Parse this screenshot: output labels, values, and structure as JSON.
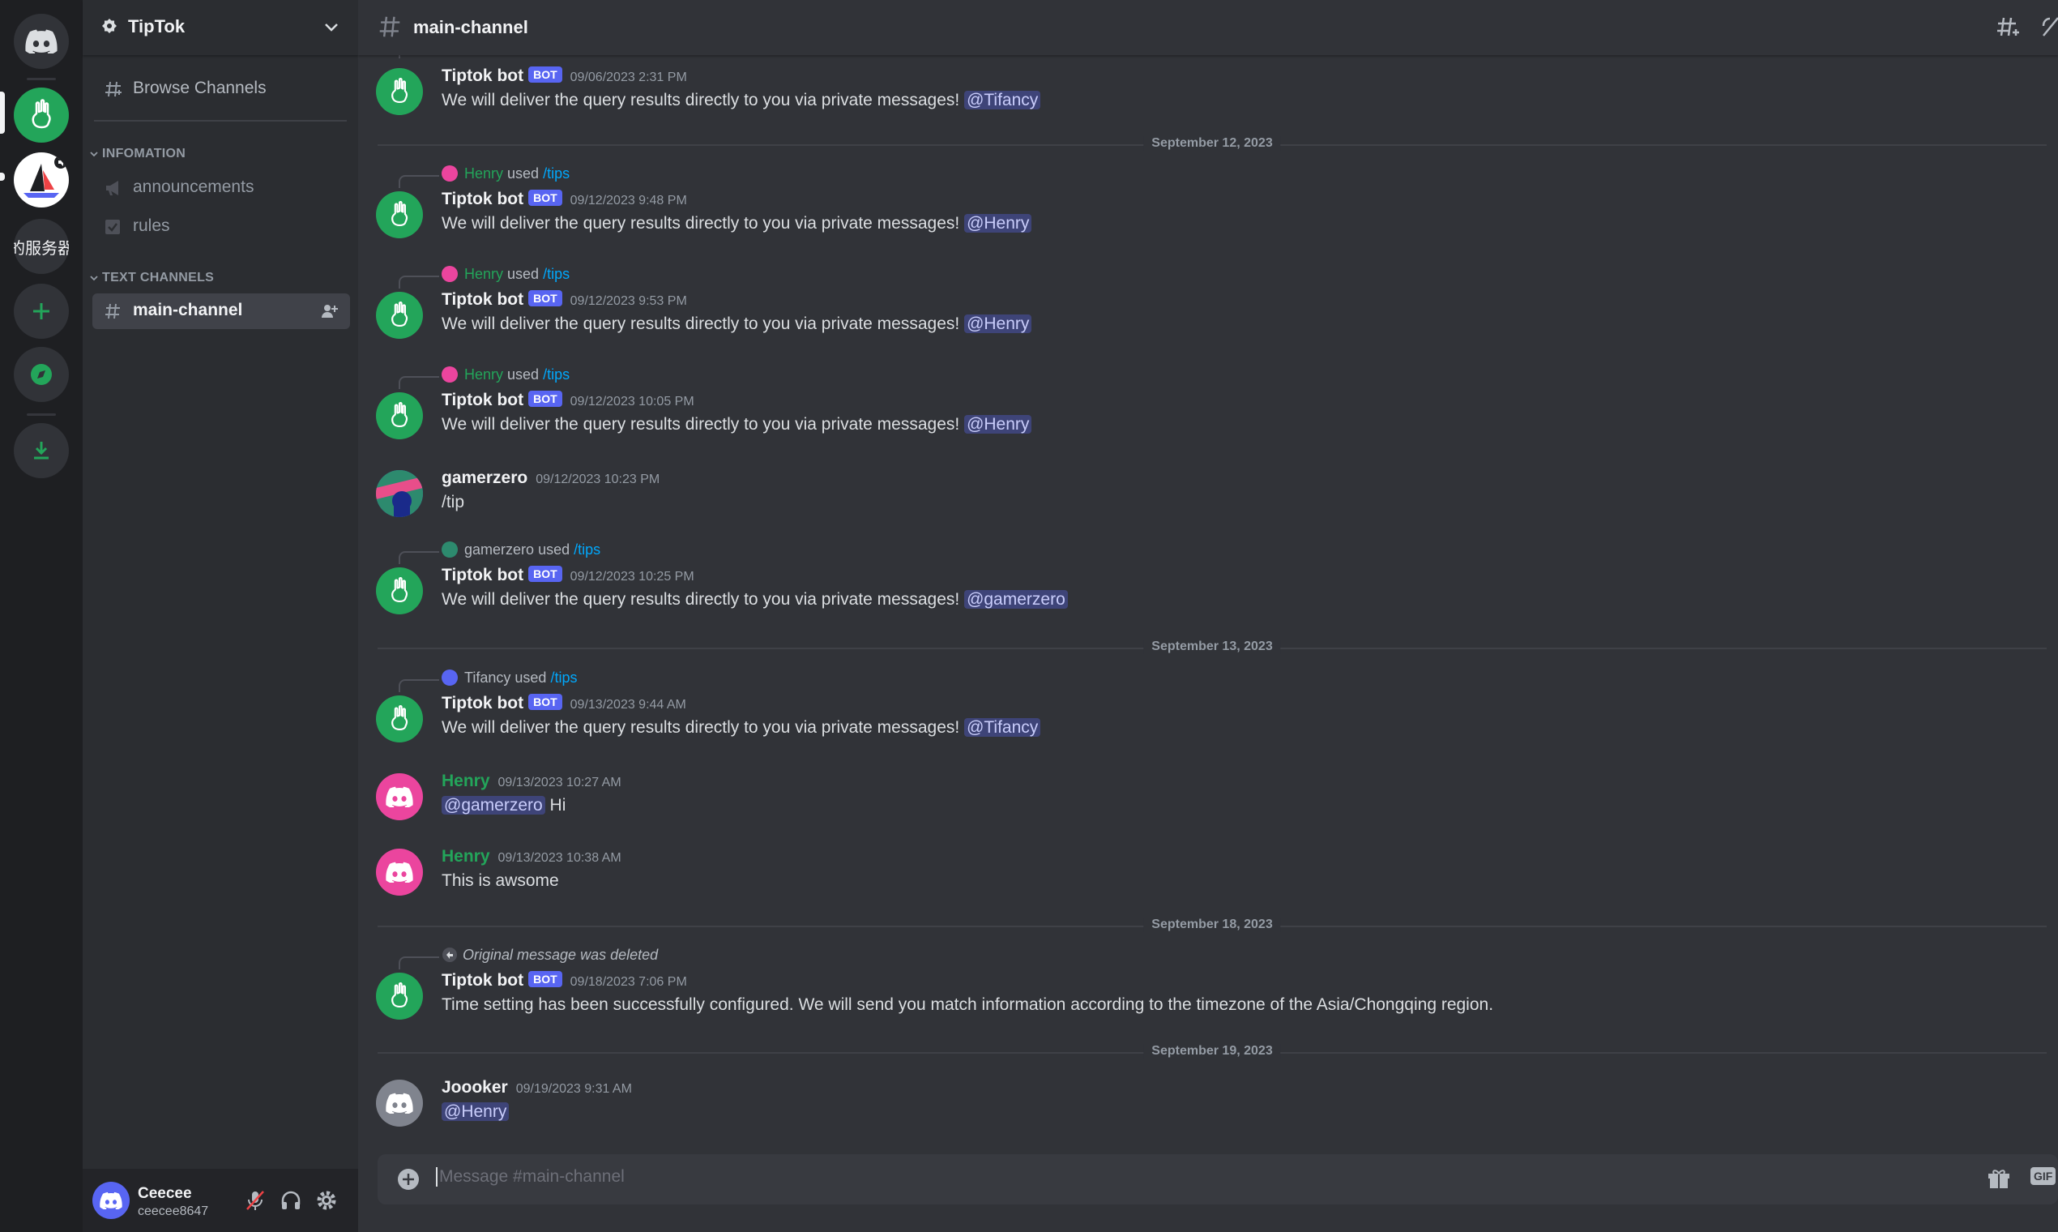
{
  "server_rail": {
    "text_server_label": "的服务器"
  },
  "guild": {
    "name": "TipTok",
    "browse_channels": "Browse Channels",
    "categories": [
      {
        "label": "INFOMATION",
        "channels": [
          "announcements",
          "rules"
        ]
      },
      {
        "label": "TEXT CHANNELS",
        "channels": [
          "main-channel"
        ]
      }
    ]
  },
  "user": {
    "display_name": "Ceecee",
    "tag": "ceecee8647"
  },
  "channel": {
    "title": "main-channel"
  },
  "composer": {
    "placeholder": "Message #main-channel",
    "gif_label": "GIF"
  },
  "dates": [
    "September 12, 2023",
    "September 13, 2023",
    "September 18, 2023",
    "September 19, 2023"
  ],
  "messages": [
    {
      "author": "Tiptok bot",
      "bot": "BOT",
      "time": "09/06/2023 2:31 PM",
      "text": "We will deliver the query results directly to you via private messages!",
      "mention": "@Tifancy"
    },
    {
      "reply_user": "Henry",
      "reply_used": "used",
      "reply_cmd": "/tips",
      "author": "Tiptok bot",
      "bot": "BOT",
      "time": "09/12/2023 9:48 PM",
      "text": "We will deliver the query results directly to you via private messages!",
      "mention": "@Henry"
    },
    {
      "reply_user": "Henry",
      "reply_used": "used",
      "reply_cmd": "/tips",
      "author": "Tiptok bot",
      "bot": "BOT",
      "time": "09/12/2023 9:53 PM",
      "text": "We will deliver the query results directly to you via private messages!",
      "mention": "@Henry"
    },
    {
      "reply_user": "Henry",
      "reply_used": "used",
      "reply_cmd": "/tips",
      "author": "Tiptok bot",
      "bot": "BOT",
      "time": "09/12/2023 10:05 PM",
      "text": "We will deliver the query results directly to you via private messages!",
      "mention": "@Henry"
    },
    {
      "author": "gamerzero",
      "time": "09/12/2023 10:23 PM",
      "text": "/tip"
    },
    {
      "reply_user": "gamerzero",
      "reply_used": "used",
      "reply_cmd": "/tips",
      "author": "Tiptok bot",
      "bot": "BOT",
      "time": "09/12/2023 10:25 PM",
      "text": "We will deliver the query results directly to you via private messages!",
      "mention": "@gamerzero"
    },
    {
      "reply_user": "Tifancy",
      "reply_used": "used",
      "reply_cmd": "/tips",
      "author": "Tiptok bot",
      "bot": "BOT",
      "time": "09/13/2023 9:44 AM",
      "text": "We will deliver the query results directly to you via private messages!",
      "mention": "@Tifancy"
    },
    {
      "author": "Henry",
      "time": "09/13/2023 10:27 AM",
      "mention": "@gamerzero",
      "text": "Hi"
    },
    {
      "author": "Henry",
      "time": "09/13/2023 10:38 AM",
      "text": "This is awsome"
    },
    {
      "reply_deleted": "Original message was deleted",
      "author": "Tiptok bot",
      "bot": "BOT",
      "time": "09/18/2023 7:06 PM",
      "text": "Time setting has been successfully configured. We will send you match information according to the timezone of the Asia/Chongqing region."
    },
    {
      "author": "Joooker",
      "time": "09/19/2023 9:31 AM",
      "mention": "@Henry"
    }
  ],
  "colors": {
    "accent": "#5865f2",
    "online_green": "#23a55a",
    "henry_pink": "#eb459e",
    "background": "#313338"
  }
}
